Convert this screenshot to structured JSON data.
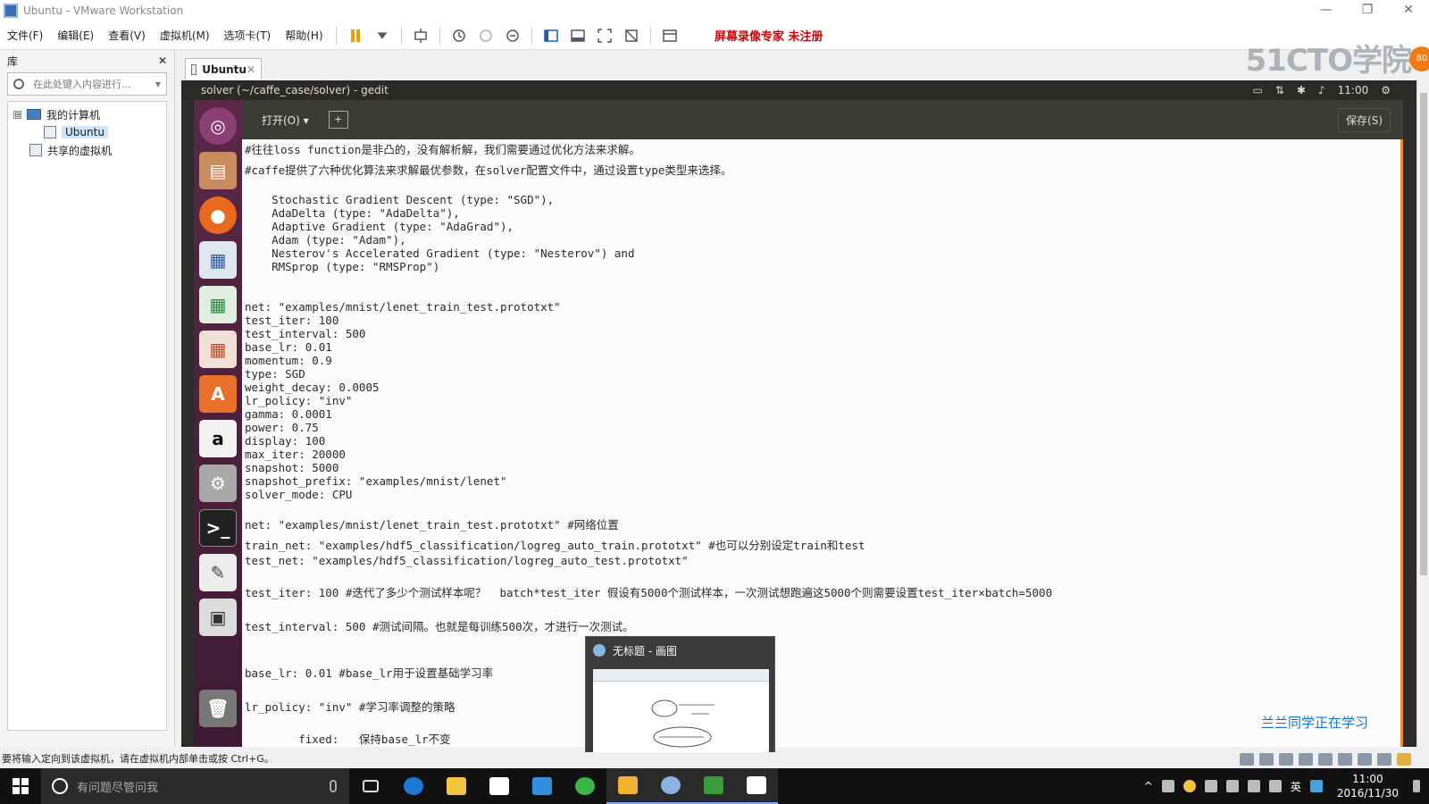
{
  "window": {
    "title": "Ubuntu - VMware Workstation",
    "controls": [
      "—",
      "❐",
      "✕"
    ]
  },
  "menu": [
    "文件(F)",
    "编辑(E)",
    "查看(V)",
    "虚拟机(M)",
    "选项卡(T)",
    "帮助(H)"
  ],
  "recorder_text": "屏幕录像专家  未注册",
  "watermark": "51CTO学院",
  "watermark_badge": "80",
  "library": {
    "title": "库",
    "close": "✕",
    "search_placeholder": "在此处键入内容进行...",
    "tree": [
      {
        "label": "我的计算机",
        "expander": "⊟"
      },
      {
        "label": "Ubuntu"
      },
      {
        "label": "共享的虚拟机"
      }
    ]
  },
  "vm_tab": {
    "label": "Ubuntu",
    "close": "✕"
  },
  "guest": {
    "title": "solver (~/caffe_case/solver) - gedit",
    "clock": "11:00",
    "open_button": "打开(O) ▾",
    "new_icon": "+",
    "save_button": "保存(S)"
  },
  "editor_lines": [
    "#往往loss function是非凸的，没有解析解，我们需要通过优化方法来求解。",
    "#caffe提供了六种优化算法来求解最优参数，在solver配置文件中，通过设置type类型来选择。",
    "    Stochastic Gradient Descent (type: \"SGD\"),",
    "    AdaDelta (type: \"AdaDelta\"),",
    "    Adaptive Gradient (type: \"AdaGrad\"),",
    "    Adam (type: \"Adam\"),",
    "    Nesterov's Accelerated Gradient (type: \"Nesterov\") and",
    "    RMSprop (type: \"RMSProp\")",
    "net: \"examples/mnist/lenet_train_test.prototxt\"",
    "test_iter: 100",
    "test_interval: 500",
    "base_lr: 0.01",
    "momentum: 0.9",
    "type: SGD",
    "weight_decay: 0.0005",
    "lr_policy: \"inv\"",
    "gamma: 0.0001",
    "power: 0.75",
    "display: 100",
    "max_iter: 20000",
    "snapshot: 5000",
    "snapshot_prefix: \"examples/mnist/lenet\"",
    "solver_mode: CPU",
    "net: \"examples/mnist/lenet_train_test.prototxt\" #网络位置",
    "train_net: \"examples/hdf5_classification/logreg_auto_train.prototxt\" #也可以分别设定train和test",
    "test_net: \"examples/hdf5_classification/logreg_auto_test.prototxt\"",
    "test_iter: 100 #迭代了多少个测试样本呢？  batch*test_iter 假设有5000个测试样本，一次测试想跑遍这5000个则需要设置test_iter×batch=5000",
    "test_interval: 500 #测试间隔。也就是每训练500次，才进行一次测试。",
    "base_lr: 0.01 #base_lr用于设置基础学习率",
    "lr_policy: \"inv\" #学习率调整的策略",
    "        fixed:   保持base_lr不变"
  ],
  "preview": {
    "title": "无标题 - 画图"
  },
  "overlay_note": "兰兰同学正在学习",
  "statusbar": {
    "text": "要将输入定向到该虚拟机，请在虚拟机内部单击或按 Ctrl+G。"
  },
  "taskbar": {
    "search_placeholder": "有问题尽管问我",
    "tray_lang": "英",
    "clock_time": "11:00",
    "clock_date": "2016/11/30"
  },
  "colors": {
    "launcher": "#5b2848",
    "recorder": "#d40000",
    "accent": "#f08a24",
    "note": "#1a74c9"
  }
}
